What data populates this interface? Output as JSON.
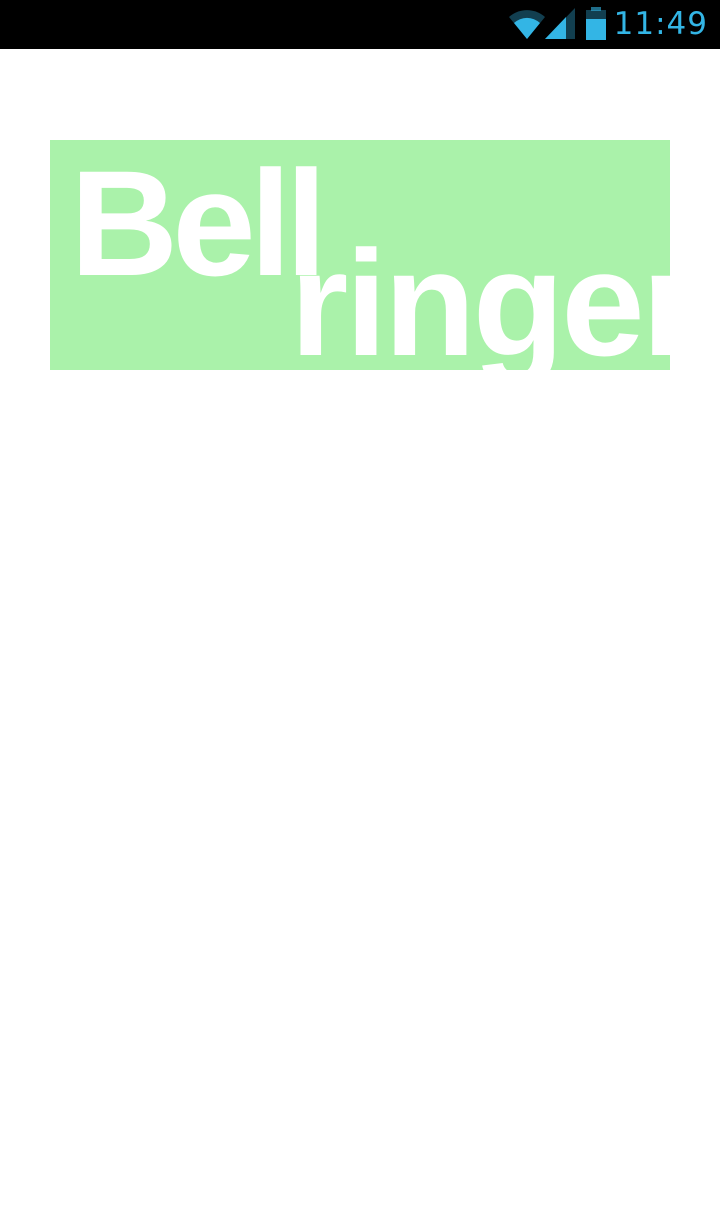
{
  "colors": {
    "status_bar_bg": "#000000",
    "status_accent": "#33b5e5",
    "logo_bg": "#aaf2aa",
    "logo_text": "#ffffff",
    "page_bg": "#ffffff"
  },
  "status_bar": {
    "time": "11:49",
    "icons": [
      "wifi-icon",
      "signal-icon",
      "battery-icon"
    ]
  },
  "splash": {
    "logo_word_1": "Bell",
    "logo_word_2": "ringer"
  }
}
